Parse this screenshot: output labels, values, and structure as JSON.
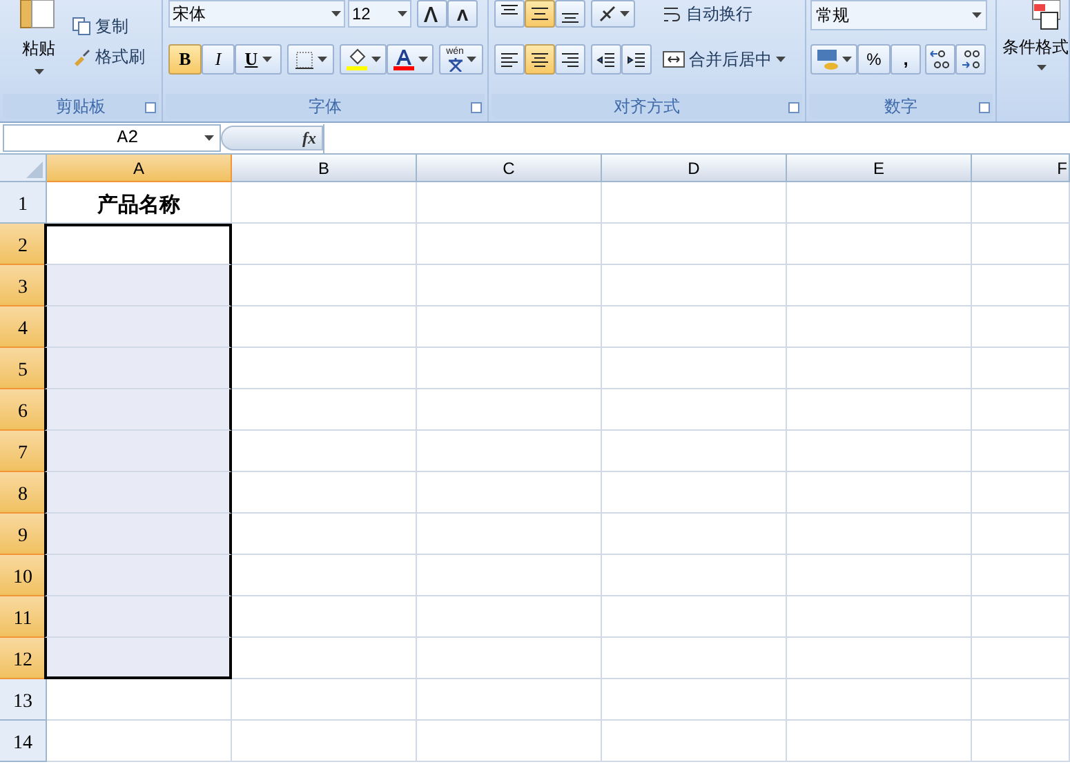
{
  "ribbon": {
    "clipboard": {
      "paste": "粘贴",
      "copy": "复制",
      "format_painter": "格式刷",
      "label": "剪贴板"
    },
    "font": {
      "font_name": "宋体",
      "font_size": "12",
      "styles": [
        {
          "kind": "bold",
          "label": "B",
          "selected": true
        },
        {
          "kind": "italic",
          "label": "I",
          "selected": false
        },
        {
          "kind": "underline",
          "label": "U",
          "selected": false
        }
      ],
      "phonetic": "wén",
      "label": "字体"
    },
    "alignment": {
      "vertical": [
        {
          "kind": "top",
          "selected": false
        },
        {
          "kind": "middle",
          "selected": true
        },
        {
          "kind": "bottom",
          "selected": false
        }
      ],
      "horizontal": [
        {
          "kind": "left",
          "selected": false
        },
        {
          "kind": "center",
          "selected": true
        },
        {
          "kind": "right",
          "selected": false
        }
      ],
      "wrap_text": "自动换行",
      "merge_center": "合并后居中",
      "label": "对齐方式"
    },
    "number": {
      "format": "常规",
      "percent": "%",
      "comma": ",",
      "label": "数字"
    },
    "styles": {
      "conditional_format": "条件格式"
    }
  },
  "name_box": "A2",
  "fx": "fx",
  "columns": [
    {
      "label": "A",
      "selected": true
    },
    {
      "label": "B",
      "selected": false
    },
    {
      "label": "C",
      "selected": false
    },
    {
      "label": "D",
      "selected": false
    },
    {
      "label": "E",
      "selected": false
    },
    {
      "label": "F",
      "selected": false
    }
  ],
  "rows": [
    {
      "label": "1",
      "selected": false,
      "a_text": "产品名称"
    },
    {
      "label": "2",
      "selected": true
    },
    {
      "label": "3",
      "selected": true
    },
    {
      "label": "4",
      "selected": true
    },
    {
      "label": "5",
      "selected": true
    },
    {
      "label": "6",
      "selected": true
    },
    {
      "label": "7",
      "selected": true
    },
    {
      "label": "8",
      "selected": true
    },
    {
      "label": "9",
      "selected": true
    },
    {
      "label": "10",
      "selected": true
    },
    {
      "label": "11",
      "selected": true
    },
    {
      "label": "12",
      "selected": true
    },
    {
      "label": "13",
      "selected": false
    },
    {
      "label": "14",
      "selected": false
    }
  ]
}
